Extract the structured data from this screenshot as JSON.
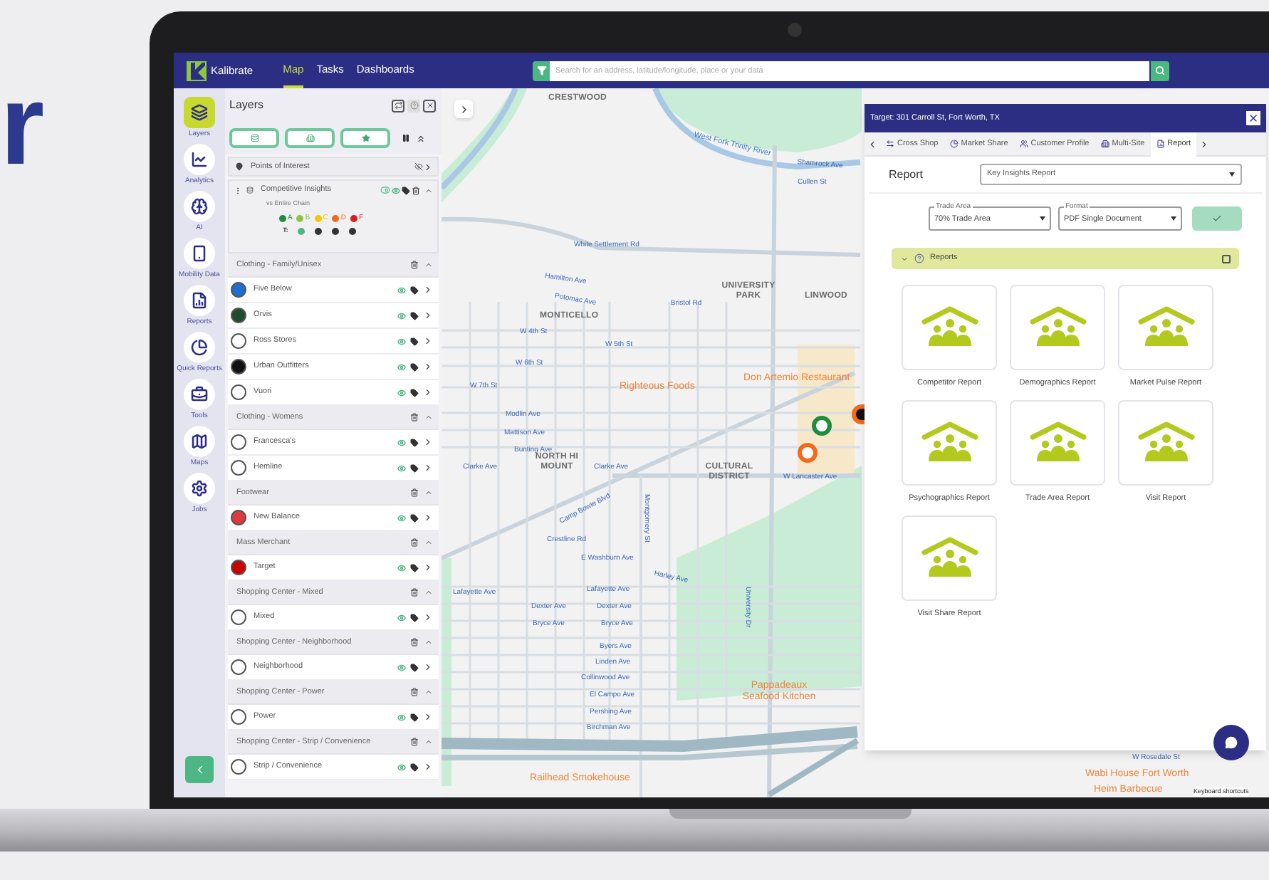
{
  "background_text": "r",
  "nav": {
    "logo": "Kalibrate",
    "links": [
      {
        "label": "Map",
        "selected": true
      },
      {
        "label": "Tasks",
        "selected": false
      },
      {
        "label": "Dashboards",
        "selected": false
      }
    ],
    "search": {
      "placeholder": "Search for an address, latitude/longitude, place or your data"
    }
  },
  "rail": {
    "items": [
      {
        "label": "Layers",
        "selected": true
      },
      {
        "label": "Analytics",
        "selected": false
      },
      {
        "label": "AI",
        "selected": false
      },
      {
        "label": "Mobility Data",
        "selected": false
      },
      {
        "label": "Reports",
        "selected": false
      },
      {
        "label": "Quick Reports",
        "selected": false
      },
      {
        "label": "Tools",
        "selected": false
      },
      {
        "label": "Maps",
        "selected": false
      },
      {
        "label": "Jobs",
        "selected": false
      }
    ]
  },
  "layers": {
    "title": "Layers",
    "poi": "Points of Interest",
    "insights": {
      "label": "Competitive Insights",
      "sub": "vs Entire Chain",
      "tier_label": "T:",
      "grades": [
        {
          "label": "A",
          "color": "#1e8e3e"
        },
        {
          "label": "B",
          "color": "#8cc63f"
        },
        {
          "label": "C",
          "color": "#f7c600"
        },
        {
          "label": "D",
          "color": "#f26b1d"
        },
        {
          "label": "F",
          "color": "#d71920"
        }
      ]
    },
    "groups": [
      {
        "name": "Clothing - Family/Unisex",
        "items": [
          {
            "name": "Five Below",
            "color": "#1f6fd1"
          },
          {
            "name": "Orvis",
            "color": "#1d4d2b"
          },
          {
            "name": "Ross Stores",
            "color": "#ffffff"
          },
          {
            "name": "Urban Outfitters",
            "color": "#111111"
          },
          {
            "name": "Vuori",
            "color": "#ffffff"
          }
        ]
      },
      {
        "name": "Clothing - Womens",
        "items": [
          {
            "name": "Francesca's",
            "color": "#ffffff"
          },
          {
            "name": "Hemline",
            "color": "#ffffff"
          }
        ]
      },
      {
        "name": "Footwear",
        "items": [
          {
            "name": "New Balance",
            "color": "#e03a3e"
          }
        ]
      },
      {
        "name": "Mass Merchant",
        "items": [
          {
            "name": "Target",
            "color": "#cc0000"
          }
        ]
      },
      {
        "name": "Shopping Center - Mixed",
        "items": [
          {
            "name": "Mixed",
            "color": "#ffffff"
          }
        ]
      },
      {
        "name": "Shopping Center - Neighborhood",
        "items": [
          {
            "name": "Neighborhood",
            "color": "#ffffff"
          }
        ]
      },
      {
        "name": "Shopping Center - Power",
        "items": [
          {
            "name": "Power",
            "color": "#ffffff"
          }
        ]
      },
      {
        "name": "Shopping Center - Strip / Convenience",
        "items": [
          {
            "name": "Strip / Convenience",
            "color": "#ffffff"
          }
        ]
      }
    ]
  },
  "map": {
    "labels": [
      {
        "text": "CRESTWOOD",
        "kind": "area"
      },
      {
        "text": "West Fork Trinity River",
        "kind": "water"
      },
      {
        "text": "White Settlement Rd",
        "kind": "street"
      },
      {
        "text": "Shamrock Ave",
        "kind": "street"
      },
      {
        "text": "Cullen St",
        "kind": "street"
      },
      {
        "text": "Hamilton Ave",
        "kind": "street"
      },
      {
        "text": "Potomac Ave",
        "kind": "street"
      },
      {
        "text": "Bristol Rd",
        "kind": "street"
      },
      {
        "text": "MONTICELLO",
        "kind": "area"
      },
      {
        "text": "UNIVERSITY PARK",
        "kind": "area"
      },
      {
        "text": "LINWOOD",
        "kind": "area"
      },
      {
        "text": "W 4th St",
        "kind": "street"
      },
      {
        "text": "W 5th St",
        "kind": "street"
      },
      {
        "text": "W 6th St",
        "kind": "street"
      },
      {
        "text": "W 7th St",
        "kind": "street"
      },
      {
        "text": "Righteous Foods",
        "kind": "place"
      },
      {
        "text": "Don Artemio Restaurant",
        "kind": "place"
      },
      {
        "text": "Modlin Ave",
        "kind": "street"
      },
      {
        "text": "Mattison Ave",
        "kind": "street"
      },
      {
        "text": "Bunting Ave",
        "kind": "street"
      },
      {
        "text": "Clarke Ave",
        "kind": "street"
      },
      {
        "text": "NORTH HI MOUNT",
        "kind": "area"
      },
      {
        "text": "Clarke Ave",
        "kind": "street"
      },
      {
        "text": "CULTURAL DISTRICT",
        "kind": "area"
      },
      {
        "text": "W Lancaster Ave",
        "kind": "street"
      },
      {
        "text": "Camp Bowie Blvd",
        "kind": "street"
      },
      {
        "text": "Crestline Rd",
        "kind": "street"
      },
      {
        "text": "E Washburn Ave",
        "kind": "street"
      },
      {
        "text": "Harley Ave",
        "kind": "street"
      },
      {
        "text": "Lafayette Ave",
        "kind": "street"
      },
      {
        "text": "Lafayette Ave",
        "kind": "street"
      },
      {
        "text": "Dexter Ave",
        "kind": "street"
      },
      {
        "text": "Dexter Ave",
        "kind": "street"
      },
      {
        "text": "Bryce Ave",
        "kind": "street"
      },
      {
        "text": "Bryce Ave",
        "kind": "street"
      },
      {
        "text": "Byers Ave",
        "kind": "street"
      },
      {
        "text": "Linden Ave",
        "kind": "street"
      },
      {
        "text": "Collinwood Ave",
        "kind": "street"
      },
      {
        "text": "El Campo Ave",
        "kind": "street"
      },
      {
        "text": "Pershing Ave",
        "kind": "street"
      },
      {
        "text": "Birchman Ave",
        "kind": "street"
      },
      {
        "text": "Pappadeaux Seafood Kitchen",
        "kind": "place"
      },
      {
        "text": "Railhead Smokehouse",
        "kind": "place"
      },
      {
        "text": "University Dr",
        "kind": "street"
      },
      {
        "text": "Montgomery St",
        "kind": "street"
      },
      {
        "text": "W Rosedale St",
        "kind": "street"
      },
      {
        "text": "Wabi House Fort Worth",
        "kind": "place"
      },
      {
        "text": "Heim Barbecue",
        "kind": "place"
      },
      {
        "text": "Keyboard shortcuts",
        "kind": "attribution"
      }
    ]
  },
  "panel": {
    "title": "Target: 301 Carroll St, Fort Worth, TX",
    "tabs": [
      {
        "label": "Cross Shop",
        "selected": false
      },
      {
        "label": "Market Share",
        "selected": false
      },
      {
        "label": "Customer Profile",
        "selected": false
      },
      {
        "label": "Multi-Site",
        "selected": false
      },
      {
        "label": "Report",
        "selected": true
      }
    ],
    "report_label": "Report",
    "report_select": "Key Insights Report",
    "trade_area": {
      "label": "Trade Area",
      "value": "70% Trade Area"
    },
    "format": {
      "label": "Format",
      "value": "PDF Single Document"
    },
    "section": {
      "title": "Reports",
      "expanded": true,
      "checked": false
    },
    "reports": [
      "Competitor Report",
      "Demographics Report",
      "Market Pulse Report",
      "Psychographics Report",
      "Trade Area Report",
      "Visit Report",
      "Visit Share Report"
    ]
  }
}
